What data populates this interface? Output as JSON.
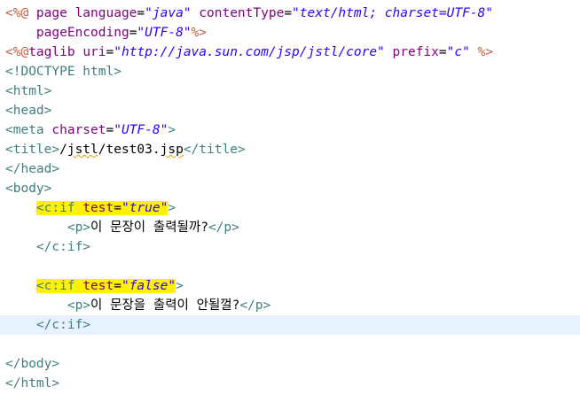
{
  "editor": {
    "lines": [
      [
        {
          "t": "<%@ ",
          "c": "directive"
        },
        {
          "t": "page ",
          "c": "attr"
        },
        {
          "t": "language",
          "c": "attr"
        },
        {
          "t": "=",
          "c": "text"
        },
        {
          "t": "\"java\"",
          "c": "value"
        },
        {
          "t": " contentType",
          "c": "attr"
        },
        {
          "t": "=",
          "c": "text"
        },
        {
          "t": "\"text/html; charset=UTF-8\"",
          "c": "value"
        }
      ],
      [
        {
          "t": "    pageEncoding",
          "c": "attr"
        },
        {
          "t": "=",
          "c": "text"
        },
        {
          "t": "\"UTF-8\"",
          "c": "value"
        },
        {
          "t": "%>",
          "c": "directive"
        }
      ],
      [
        {
          "t": "<%@",
          "c": "directive"
        },
        {
          "t": "taglib ",
          "c": "attr"
        },
        {
          "t": "uri",
          "c": "attr"
        },
        {
          "t": "=",
          "c": "text"
        },
        {
          "t": "\"http://java.sun.com/jsp/jstl/core\"",
          "c": "value"
        },
        {
          "t": " prefix",
          "c": "attr"
        },
        {
          "t": "=",
          "c": "text"
        },
        {
          "t": "\"c\"",
          "c": "value"
        },
        {
          "t": " %>",
          "c": "directive"
        }
      ],
      [
        {
          "t": "<!DOCTYPE html>",
          "c": "tag"
        }
      ],
      [
        {
          "t": "<html>",
          "c": "tag"
        }
      ],
      [
        {
          "t": "<head>",
          "c": "tag"
        }
      ],
      [
        {
          "t": "<meta ",
          "c": "tag"
        },
        {
          "t": "charset",
          "c": "attr"
        },
        {
          "t": "=",
          "c": "text"
        },
        {
          "t": "\"UTF-8\"",
          "c": "value"
        },
        {
          "t": ">",
          "c": "tag"
        }
      ],
      [
        {
          "t": "<title>",
          "c": "tag"
        },
        {
          "t": "/",
          "c": "text"
        },
        {
          "t": "jstl",
          "c": "text",
          "sq": true
        },
        {
          "t": "/test03.",
          "c": "text"
        },
        {
          "t": "jsp",
          "c": "text",
          "sq": true
        },
        {
          "t": "</title>",
          "c": "tag"
        }
      ],
      [
        {
          "t": "</head>",
          "c": "tag"
        }
      ],
      [
        {
          "t": "<body>",
          "c": "tag"
        }
      ],
      [
        {
          "t": "    ",
          "c": "text"
        },
        {
          "t": "<c:if ",
          "c": "tag",
          "hl": true
        },
        {
          "t": "test",
          "c": "attr",
          "hl": true
        },
        {
          "t": "=",
          "c": "text",
          "hl": true
        },
        {
          "t": "\"true\"",
          "c": "value",
          "hl": true
        },
        {
          "t": ">",
          "c": "tag"
        }
      ],
      [
        {
          "t": "        <p>",
          "c": "tag"
        },
        {
          "t": "이 문장이 출력될까?",
          "c": "text"
        },
        {
          "t": "</p>",
          "c": "tag"
        }
      ],
      [
        {
          "t": "    </c:if>",
          "c": "tag"
        }
      ],
      [
        {
          "t": "",
          "c": "text"
        }
      ],
      [
        {
          "t": "    ",
          "c": "text"
        },
        {
          "t": "<c:if ",
          "c": "tag",
          "hl": true
        },
        {
          "t": "test",
          "c": "attr",
          "hl": true
        },
        {
          "t": "=",
          "c": "text",
          "hl": true
        },
        {
          "t": "\"false\"",
          "c": "value",
          "hl": true
        },
        {
          "t": ">",
          "c": "tag"
        }
      ],
      [
        {
          "t": "        <p>",
          "c": "tag"
        },
        {
          "t": "이 문장을 출력이 안될껄?",
          "c": "text"
        },
        {
          "t": "</p>",
          "c": "tag"
        }
      ],
      [
        {
          "t": "    </c:if>",
          "c": "tag"
        }
      ],
      [
        {
          "t": "",
          "c": "text"
        }
      ],
      [
        {
          "t": "</body>",
          "c": "tag"
        }
      ],
      [
        {
          "t": "</html>",
          "c": "tag"
        }
      ]
    ]
  }
}
